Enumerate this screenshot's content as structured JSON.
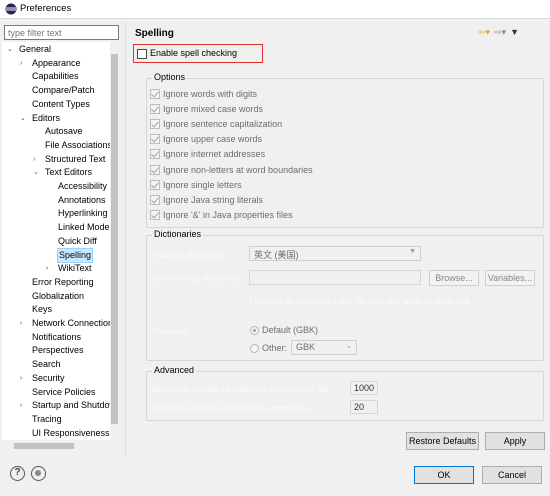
{
  "window": {
    "title": "Preferences"
  },
  "filter": {
    "placeholder": "type filter text"
  },
  "tree": [
    {
      "label": "General",
      "indent": 0,
      "arrow": "open"
    },
    {
      "label": "Appearance",
      "indent": 1,
      "arrow": "closed"
    },
    {
      "label": "Capabilities",
      "indent": 1,
      "arrow": ""
    },
    {
      "label": "Compare/Patch",
      "indent": 1,
      "arrow": ""
    },
    {
      "label": "Content Types",
      "indent": 1,
      "arrow": ""
    },
    {
      "label": "Editors",
      "indent": 1,
      "arrow": "open"
    },
    {
      "label": "Autosave",
      "indent": 2,
      "arrow": ""
    },
    {
      "label": "File Associations",
      "indent": 2,
      "arrow": ""
    },
    {
      "label": "Structured Text",
      "indent": 2,
      "arrow": "closed"
    },
    {
      "label": "Text Editors",
      "indent": 2,
      "arrow": "open"
    },
    {
      "label": "Accessibility",
      "indent": 3,
      "arrow": ""
    },
    {
      "label": "Annotations",
      "indent": 3,
      "arrow": ""
    },
    {
      "label": "Hyperlinking",
      "indent": 3,
      "arrow": ""
    },
    {
      "label": "Linked Mode",
      "indent": 3,
      "arrow": ""
    },
    {
      "label": "Quick Diff",
      "indent": 3,
      "arrow": ""
    },
    {
      "label": "Spelling",
      "indent": 3,
      "arrow": "",
      "selected": true
    },
    {
      "label": "WikiText",
      "indent": 3,
      "arrow": "closed"
    },
    {
      "label": "Error Reporting",
      "indent": 1,
      "arrow": ""
    },
    {
      "label": "Globalization",
      "indent": 1,
      "arrow": ""
    },
    {
      "label": "Keys",
      "indent": 1,
      "arrow": ""
    },
    {
      "label": "Network Connections",
      "indent": 1,
      "arrow": "closed"
    },
    {
      "label": "Notifications",
      "indent": 1,
      "arrow": ""
    },
    {
      "label": "Perspectives",
      "indent": 1,
      "arrow": ""
    },
    {
      "label": "Search",
      "indent": 1,
      "arrow": ""
    },
    {
      "label": "Security",
      "indent": 1,
      "arrow": "closed"
    },
    {
      "label": "Service Policies",
      "indent": 1,
      "arrow": ""
    },
    {
      "label": "Startup and Shutdown",
      "indent": 1,
      "arrow": "closed"
    },
    {
      "label": "Tracing",
      "indent": 1,
      "arrow": ""
    },
    {
      "label": "UI Responsiveness",
      "indent": 1,
      "arrow": ""
    }
  ],
  "page": {
    "title": "Spelling",
    "enable_label": "Enable spell checking",
    "options_legend": "Options",
    "options": [
      "Ignore words with digits",
      "Ignore mixed case words",
      "Ignore sentence capitalization",
      "Ignore upper case words",
      "Ignore internet addresses",
      "Ignore non-letters at word boundaries",
      "Ignore single letters",
      "Ignore Java string literals",
      "Ignore '&' in Java properties files"
    ],
    "dictionaries_legend": "Dictionaries",
    "platform_dictionary_label": "Platform dictionary:",
    "platform_dictionary_value": "英文 (美国)",
    "user_dictionary_label": "User defined dictionary:",
    "browse_label": "Browse...",
    "variables_label": "Variables...",
    "user_dict_hint": "The user dictionary is a text file with one word on each line",
    "encoding_label": "Encoding:",
    "default_radio_label": "Default (GBK)",
    "other_radio_label": "Other:",
    "other_encoding_value": "GBK",
    "advanced_legend": "Advanced",
    "max_problems_label": "Maximum number of problems reported per file:",
    "max_problems_value": "1000",
    "max_proposals_label": "Maximum number of correction proposals:",
    "max_proposals_value": "20",
    "restore_defaults_label": "Restore Defaults",
    "apply_label": "Apply"
  },
  "footer": {
    "ok_label": "OK",
    "cancel_label": "Cancel"
  },
  "icons": {
    "back": "back-arrow-icon",
    "forward": "forward-arrow-icon",
    "menu": "view-menu-icon",
    "help": "help-icon",
    "record": "record-macro-icon"
  }
}
